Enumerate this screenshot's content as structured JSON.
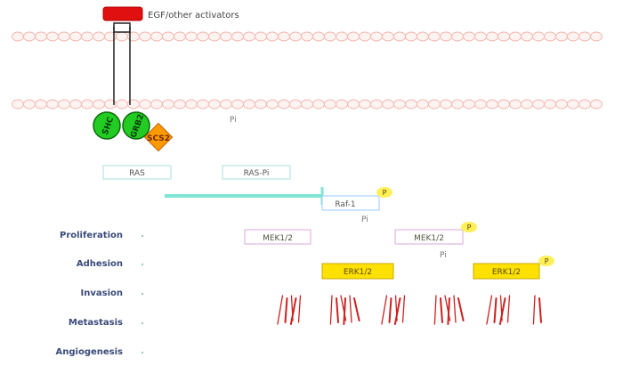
{
  "ligand": {
    "label": "EGF/other activators"
  },
  "adaptors": {
    "shc": "SHC",
    "grb": "GRB2",
    "scs": "SCS2"
  },
  "labels": {
    "pi_membrane": "Pi",
    "ras": "RAS",
    "ras_pi": "RAS-Pi",
    "raf": "Raf-1",
    "raf_p": "P",
    "raf_pi": "Pi",
    "mek": "MEK1/2",
    "mek_p_label": "MEK1/2",
    "mek_p": "P",
    "mek_pi": "Pi",
    "erk": "ERK1/2",
    "erk_p_label": "ERK1/2",
    "erk_p": "P"
  },
  "outcomes": [
    "Proliferation",
    "Adhesion",
    "Invasion",
    "Metastasis",
    "Angiogenesis"
  ],
  "colors": {
    "membrane": "#f2b8b0",
    "ligand": "#e01010",
    "adaptor_green": "#22cc22",
    "scs_orange": "#ff9900",
    "ras_box": "#a8e0dc",
    "arrow": "#7fe6d4",
    "raf_box": "#99c8ff",
    "mek_box": "#d8a8d8",
    "erk_fill": "#ffe100",
    "p_badge": "#fff05a",
    "outcome_text": "#3a4a7a",
    "dna": "#cc2222"
  }
}
